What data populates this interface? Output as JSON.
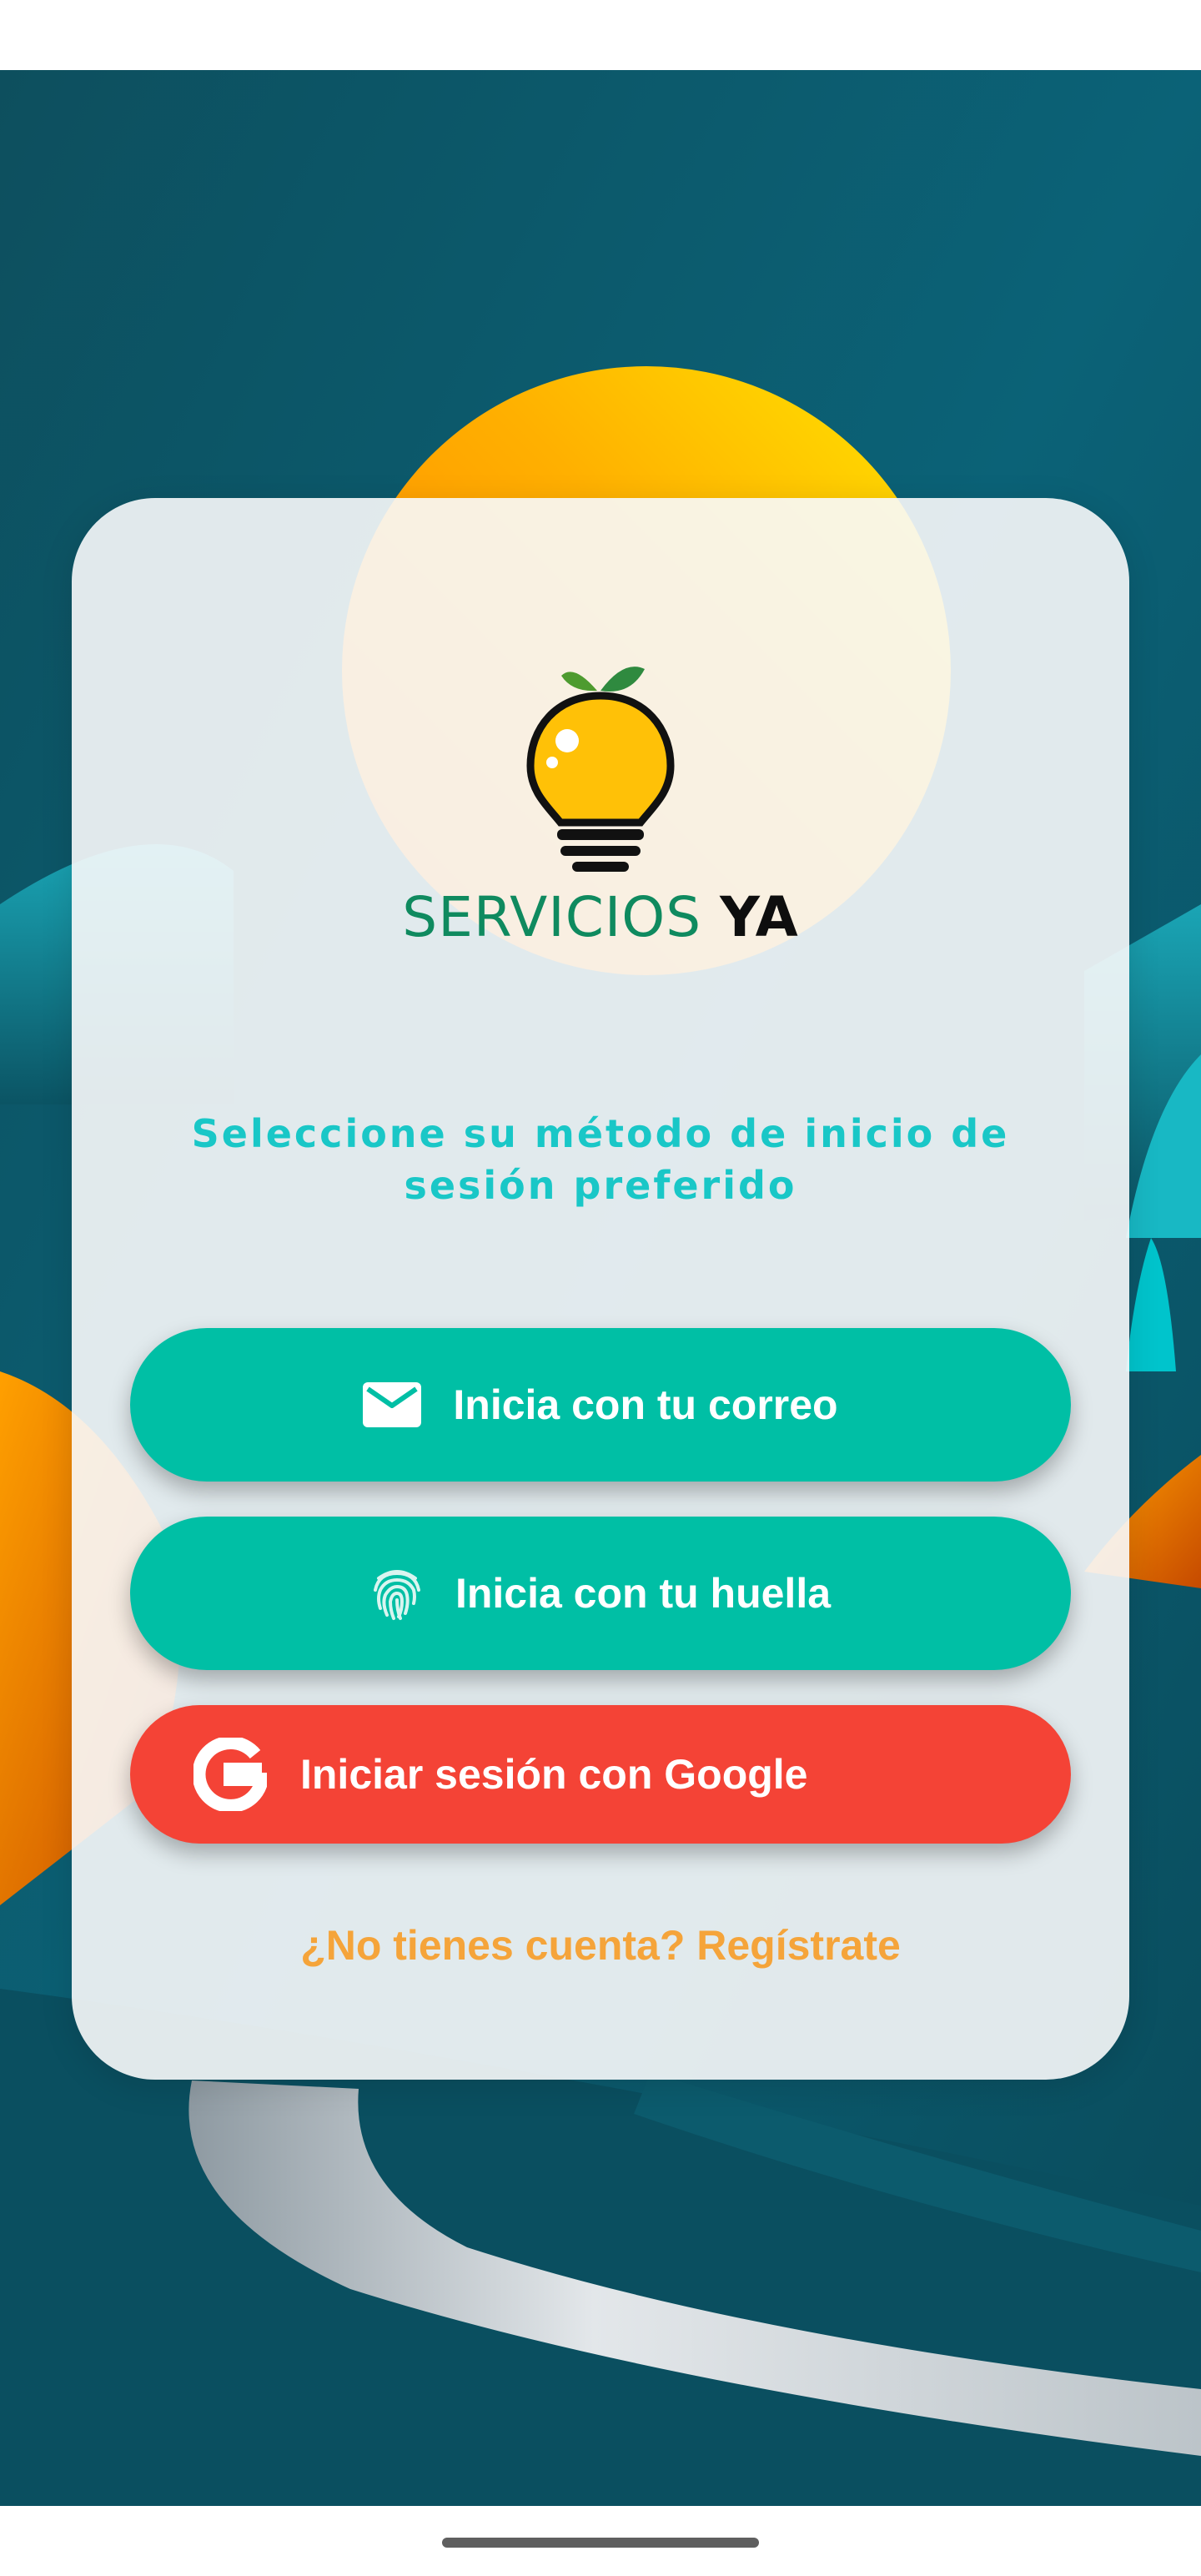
{
  "app": {
    "brand_part1": "SERVICIOS",
    "brand_part2": "YA",
    "logo_icon": "lightbulb-leaf-icon"
  },
  "login": {
    "prompt": "Seleccione su método de inicio de sesión preferido",
    "buttons": [
      {
        "label": "Inicia con tu correo",
        "icon": "mail-icon",
        "color": "#00bfa5"
      },
      {
        "label": "Inicia con tu huella",
        "icon": "fingerprint-icon",
        "color": "#00bfa5"
      },
      {
        "label": "Iniciar sesión con Google",
        "icon": "google-icon",
        "color": "#f44336"
      }
    ],
    "register_link": "¿No tienes cuenta? Regístrate"
  },
  "colors": {
    "accent_teal": "#00bfa5",
    "prompt_cyan": "#19c7c7",
    "google_red": "#f44336",
    "link_orange": "#f5a43a",
    "brand_green": "#0f8a5f"
  }
}
